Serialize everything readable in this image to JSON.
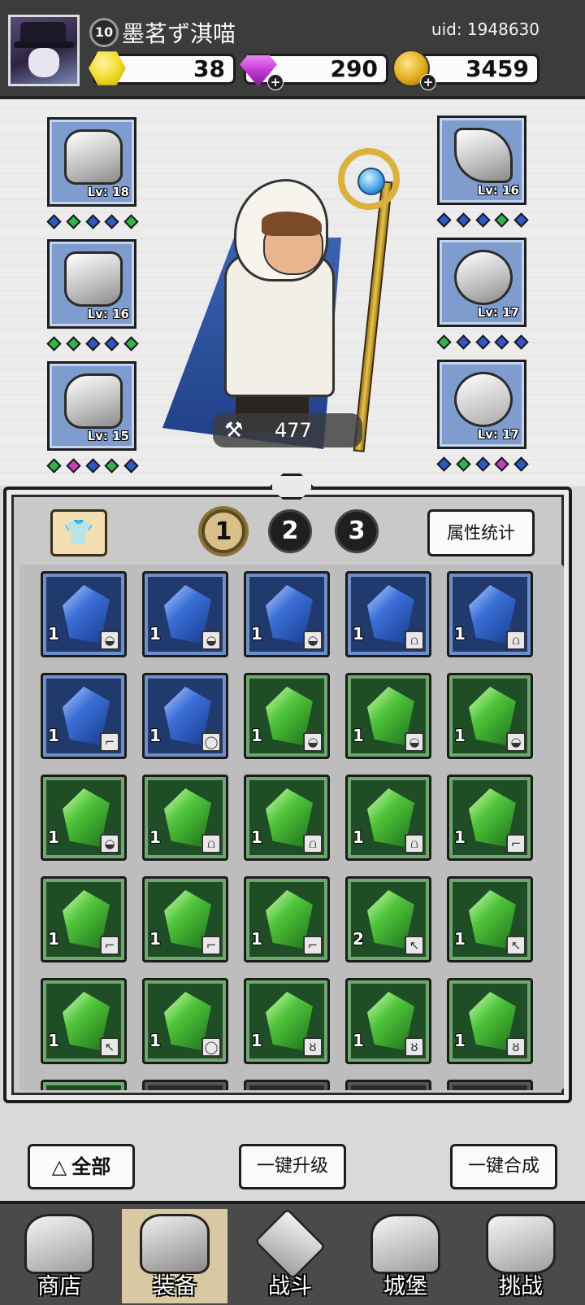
{
  "player": {
    "level": "10",
    "name": "墨茗ず淇喵",
    "uid": "uid: 1948630"
  },
  "resources": {
    "gold": "38",
    "gems": "290",
    "coins": "3459",
    "plus": "+"
  },
  "equipment": {
    "left": [
      {
        "slot": "helmet",
        "level": "Lv: 18",
        "gems": [
          "blue",
          "green",
          "blue",
          "blue",
          "green"
        ]
      },
      {
        "slot": "armor",
        "level": "Lv: 16",
        "gems": [
          "green",
          "green",
          "blue",
          "blue",
          "green"
        ]
      },
      {
        "slot": "boots",
        "level": "Lv: 15",
        "gems": [
          "green",
          "magenta",
          "blue",
          "green",
          "blue"
        ]
      }
    ],
    "right": [
      {
        "slot": "weapon",
        "level": "Lv: 16",
        "gems": [
          "blue",
          "blue",
          "blue",
          "green",
          "blue"
        ]
      },
      {
        "slot": "ring",
        "level": "Lv: 17",
        "gems": [
          "green",
          "blue",
          "blue",
          "blue",
          "blue"
        ]
      },
      {
        "slot": "necklace",
        "level": "Lv: 17",
        "gems": [
          "blue",
          "green",
          "blue",
          "magenta",
          "blue"
        ]
      }
    ]
  },
  "hero": {
    "power_icon": "weapon-power-icon",
    "power": "477"
  },
  "inventory": {
    "set_tabs": [
      "1",
      "2",
      "3"
    ],
    "active_tab": "1",
    "stats_label": "属性统计",
    "items": [
      {
        "color": "blue",
        "qty": "1",
        "slot_icon": "helmet"
      },
      {
        "color": "blue",
        "qty": "1",
        "slot_icon": "helmet"
      },
      {
        "color": "blue",
        "qty": "1",
        "slot_icon": "helmet"
      },
      {
        "color": "blue",
        "qty": "1",
        "slot_icon": "armor"
      },
      {
        "color": "blue",
        "qty": "1",
        "slot_icon": "armor"
      },
      {
        "color": "blue",
        "qty": "1",
        "slot_icon": "boots"
      },
      {
        "color": "blue",
        "qty": "1",
        "slot_icon": "ring"
      },
      {
        "color": "green",
        "qty": "1",
        "slot_icon": "helmet"
      },
      {
        "color": "green",
        "qty": "1",
        "slot_icon": "helmet"
      },
      {
        "color": "green",
        "qty": "1",
        "slot_icon": "helmet"
      },
      {
        "color": "green",
        "qty": "1",
        "slot_icon": "helmet"
      },
      {
        "color": "green",
        "qty": "1",
        "slot_icon": "armor"
      },
      {
        "color": "green",
        "qty": "1",
        "slot_icon": "armor"
      },
      {
        "color": "green",
        "qty": "1",
        "slot_icon": "armor"
      },
      {
        "color": "green",
        "qty": "1",
        "slot_icon": "boots"
      },
      {
        "color": "green",
        "qty": "1",
        "slot_icon": "boots"
      },
      {
        "color": "green",
        "qty": "1",
        "slot_icon": "boots"
      },
      {
        "color": "green",
        "qty": "1",
        "slot_icon": "boots"
      },
      {
        "color": "green",
        "qty": "2",
        "slot_icon": "weapon"
      },
      {
        "color": "green",
        "qty": "1",
        "slot_icon": "weapon"
      },
      {
        "color": "green",
        "qty": "1",
        "slot_icon": "weapon"
      },
      {
        "color": "green",
        "qty": "1",
        "slot_icon": "ring"
      },
      {
        "color": "green",
        "qty": "1",
        "slot_icon": "necklace"
      },
      {
        "color": "green",
        "qty": "1",
        "slot_icon": "necklace"
      },
      {
        "color": "green",
        "qty": "1",
        "slot_icon": "necklace"
      },
      {
        "color": "green",
        "qty": "",
        "slot_icon": ""
      },
      {
        "color": "dark",
        "qty": "",
        "slot_icon": ""
      },
      {
        "color": "dark",
        "qty": "",
        "slot_icon": ""
      },
      {
        "color": "dark",
        "qty": "",
        "slot_icon": ""
      },
      {
        "color": "dark",
        "qty": "",
        "slot_icon": ""
      }
    ]
  },
  "actions": {
    "filter_all": "全部",
    "upgrade_all": "一键升级",
    "merge_all": "一键合成"
  },
  "nav": {
    "shop": "商店",
    "equipment": "装备",
    "battle": "战斗",
    "castle": "城堡",
    "challenge": "挑战"
  },
  "colors": {
    "blue_gem": "#2f58c6",
    "green_gem": "#34b34a",
    "magenta_gem": "#c43fc4"
  }
}
